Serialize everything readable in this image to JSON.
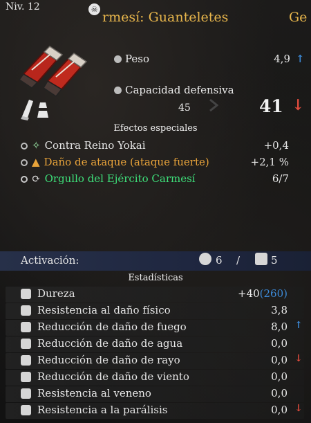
{
  "header": {
    "level": "Niv. 12",
    "title": "rmesí: Guanteletes",
    "title_next": "Ge"
  },
  "weight": {
    "label": "Peso",
    "value": "4,9",
    "arrow": "↑"
  },
  "defense": {
    "label": "Capacidad defensiva",
    "old": "45",
    "new": "41",
    "arrow": "↓"
  },
  "effects": {
    "heading": "Efectos especiales",
    "items": [
      {
        "label": "Contra Reino Yokai",
        "value": "+0,4",
        "color": "#e6e6e6",
        "marker": "✧"
      },
      {
        "label": "Daño de ataque (ataque fuerte)",
        "value": "+2,1 %",
        "color": "#e8a33a",
        "marker": "▲"
      },
      {
        "label": "Orgullo del Ejército Carmesí",
        "value": "6/7",
        "color": "#3ee07a",
        "marker": "⟳"
      }
    ]
  },
  "activation": {
    "label": "Activación:",
    "a": "6",
    "sep": "/",
    "b": "5"
  },
  "stats": {
    "heading": "Estadísticas",
    "rows": [
      {
        "label": "Dureza",
        "value": "+40",
        "extra": "(260)",
        "arrow": ""
      },
      {
        "label": "Resistencia al daño físico",
        "value": "3,8",
        "arrow": ""
      },
      {
        "label": "Reducción de daño de fuego",
        "value": "8,0",
        "arrow": "↑"
      },
      {
        "label": "Reducción de daño de agua",
        "value": "0,0",
        "arrow": ""
      },
      {
        "label": "Reducción de daño de rayo",
        "value": "0,0",
        "arrow": "↓"
      },
      {
        "label": "Reducción de daño de viento",
        "value": "0,0",
        "arrow": ""
      },
      {
        "label": "Resistencia al veneno",
        "value": "0,0",
        "arrow": ""
      },
      {
        "label": "Resistencia a la parálisis",
        "value": "0,0",
        "arrow": "↓"
      }
    ]
  }
}
